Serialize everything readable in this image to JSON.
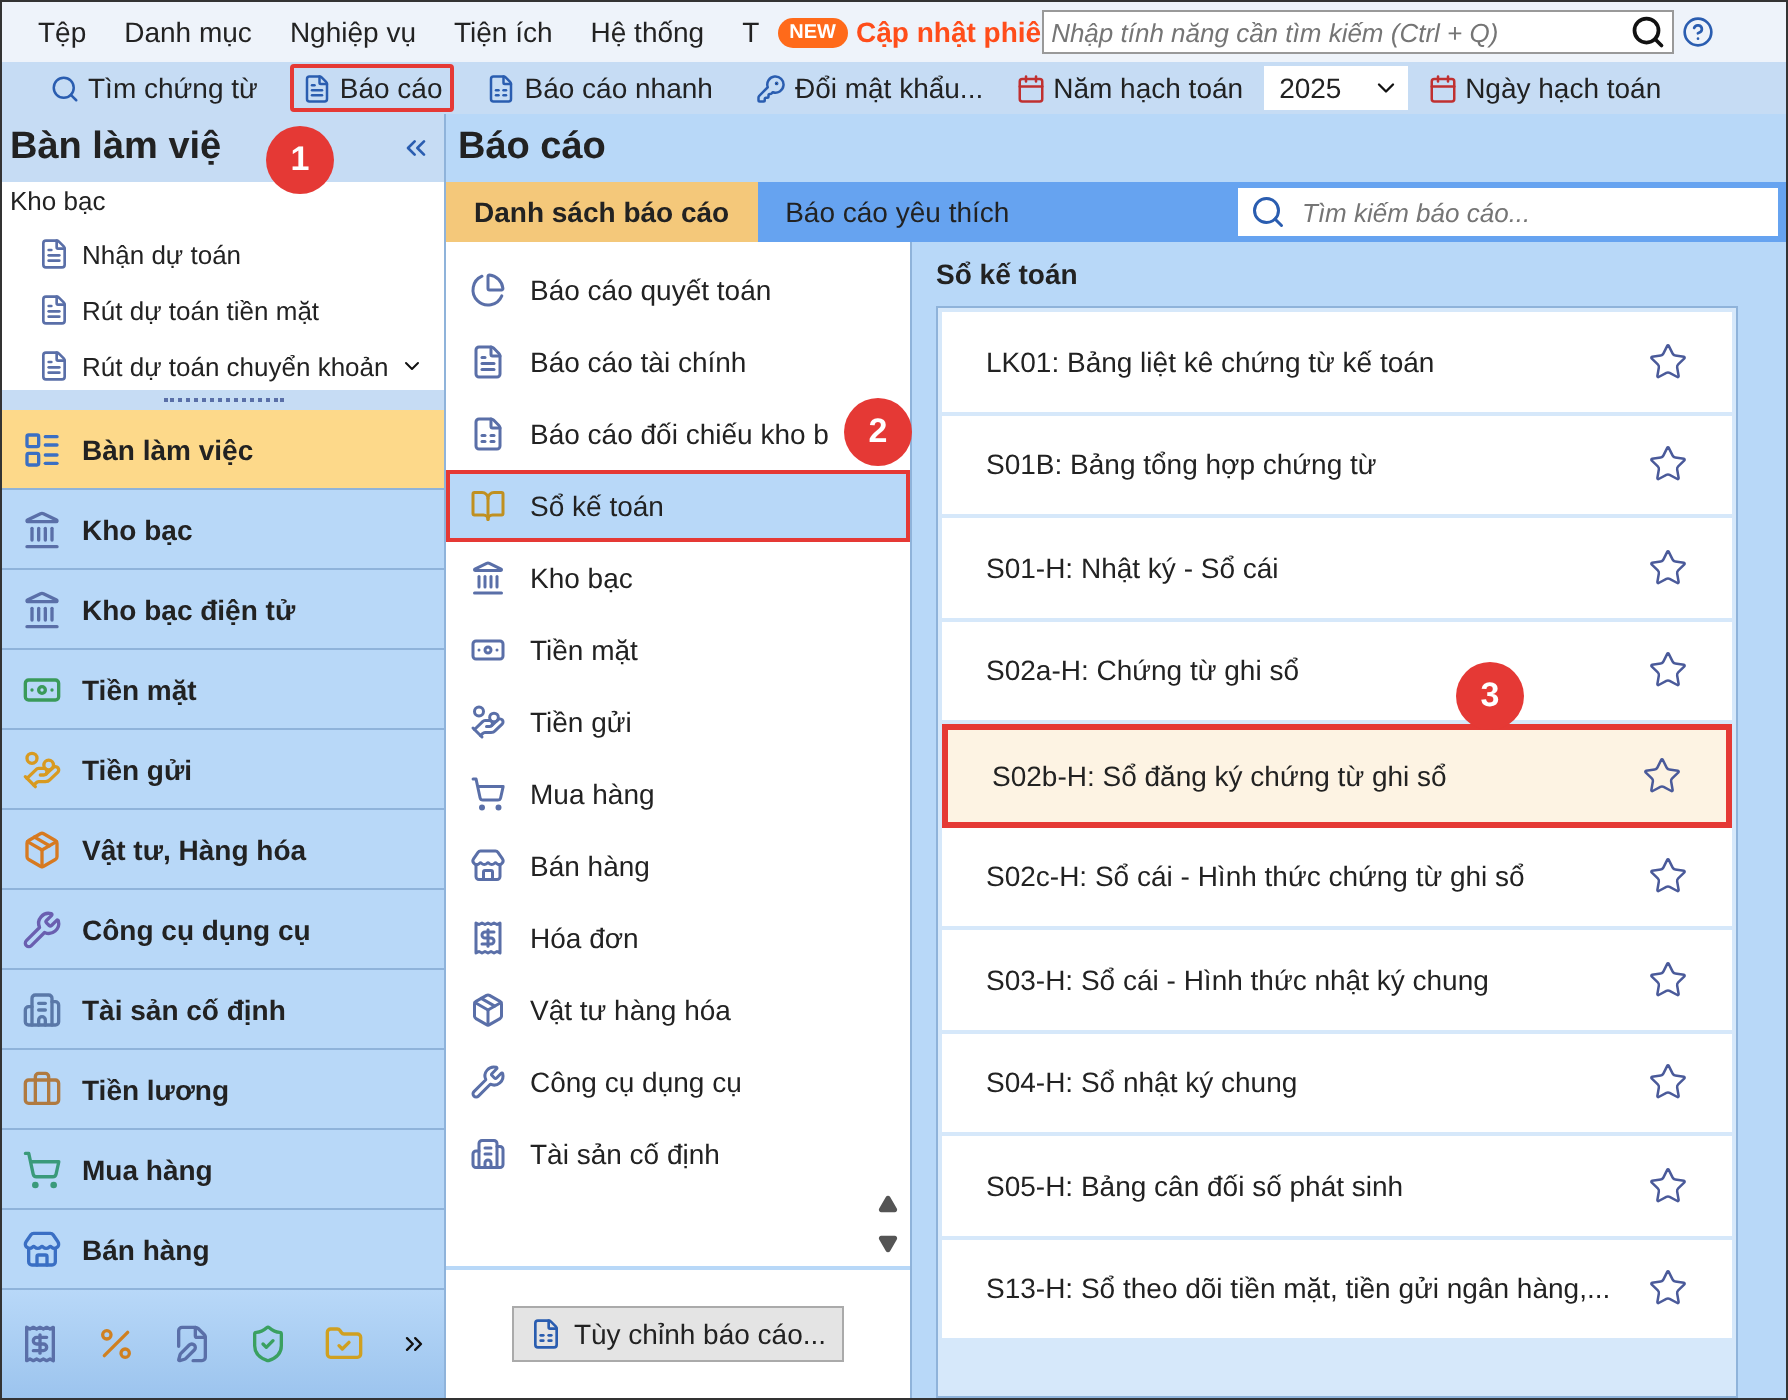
{
  "menu_bar": {
    "items": [
      "Tệp",
      "Danh mục",
      "Nghiệp vụ",
      "Tiện ích",
      "Hệ thống",
      "T"
    ],
    "new_badge": "NEW",
    "update_text": "Cập nhật phiê",
    "search": {
      "placeholder": "Nhập tính năng cần tìm kiếm (Ctrl + Q)"
    }
  },
  "toolbar": {
    "items": [
      {
        "label": "Tìm chứng từ",
        "highlighted": false
      },
      {
        "label": "Báo cáo",
        "highlighted": true
      },
      {
        "label": "Báo cáo nhanh",
        "highlighted": false
      },
      {
        "label": "Đổi mật khẩu...",
        "highlighted": false
      }
    ],
    "year_label": "Năm hạch toán",
    "year_value": "2025",
    "date_label": "Ngày hạch toán"
  },
  "sidebar": {
    "title": "Bàn làm việ",
    "tree": [
      {
        "label": "Kho bạc",
        "children": [
          {
            "label": "Nhận dự toán"
          },
          {
            "label": "Rút dự toán tiền mặt"
          },
          {
            "label": "Rút dự toán chuyển khoản"
          }
        ]
      }
    ],
    "items": [
      {
        "label": "Bàn làm việc",
        "selected": true
      },
      {
        "label": "Kho bạc",
        "selected": false
      },
      {
        "label": "Kho bạc điện tử",
        "selected": false
      },
      {
        "label": "Tiền mặt",
        "selected": false
      },
      {
        "label": "Tiền gửi",
        "selected": false
      },
      {
        "label": "Vật tư, Hàng hóa",
        "selected": false
      },
      {
        "label": "Công cụ dụng cụ",
        "selected": false
      },
      {
        "label": "Tài sản cố định",
        "selected": false
      },
      {
        "label": "Tiền lương",
        "selected": false
      },
      {
        "label": "Mua hàng",
        "selected": false
      },
      {
        "label": "Bán hàng",
        "selected": false
      }
    ]
  },
  "main": {
    "title": "Báo cáo",
    "tabs": [
      {
        "label": "Danh sách báo cáo",
        "selected": true
      },
      {
        "label": "Báo cáo yêu thích",
        "selected": false
      }
    ],
    "search": {
      "placeholder": "Tìm kiếm báo cáo..."
    },
    "categories": [
      {
        "label": "Báo cáo quyết toán",
        "selected": false
      },
      {
        "label": "Báo cáo tài chính",
        "selected": false
      },
      {
        "label": "Báo cáo đối chiếu kho b",
        "selected": false
      },
      {
        "label": "Sổ kế toán",
        "selected": true
      },
      {
        "label": "Kho bạc",
        "selected": false
      },
      {
        "label": "Tiền mặt",
        "selected": false
      },
      {
        "label": "Tiền gửi",
        "selected": false
      },
      {
        "label": "Mua hàng",
        "selected": false
      },
      {
        "label": "Bán hàng",
        "selected": false
      },
      {
        "label": "Hóa đơn",
        "selected": false
      },
      {
        "label": "Vật tư hàng hóa",
        "selected": false
      },
      {
        "label": "Công cụ dụng cụ",
        "selected": false
      },
      {
        "label": "Tài sản cố định",
        "selected": false
      }
    ],
    "customize_button": "Tùy chỉnh báo cáo...",
    "reports_heading": "Sổ kế toán",
    "reports": [
      {
        "label": "LK01: Bảng liệt kê chứng từ kế toán",
        "selected": false
      },
      {
        "label": "S01B: Bảng tổng hợp chứng từ",
        "selected": false
      },
      {
        "label": "S01-H: Nhật ký - Sổ cái",
        "selected": false
      },
      {
        "label": "S02a-H: Chứng từ ghi sổ",
        "selected": false
      },
      {
        "label": "S02b-H: Sổ đăng ký chứng từ ghi sổ",
        "selected": true
      },
      {
        "label": "S02c-H: Sổ cái - Hình thức chứng từ ghi sổ",
        "selected": false
      },
      {
        "label": "S03-H: Sổ cái - Hình thức nhật ký chung",
        "selected": false
      },
      {
        "label": "S04-H: Sổ nhật ký chung",
        "selected": false
      },
      {
        "label": "S05-H: Bảng cân đối số phát sinh",
        "selected": false
      },
      {
        "label": "S13-H: Sổ theo dõi tiền mặt, tiền gửi ngân hàng,...",
        "selected": false
      }
    ]
  },
  "callouts": [
    {
      "label": "1"
    },
    {
      "label": "2"
    },
    {
      "label": "3"
    }
  ]
}
